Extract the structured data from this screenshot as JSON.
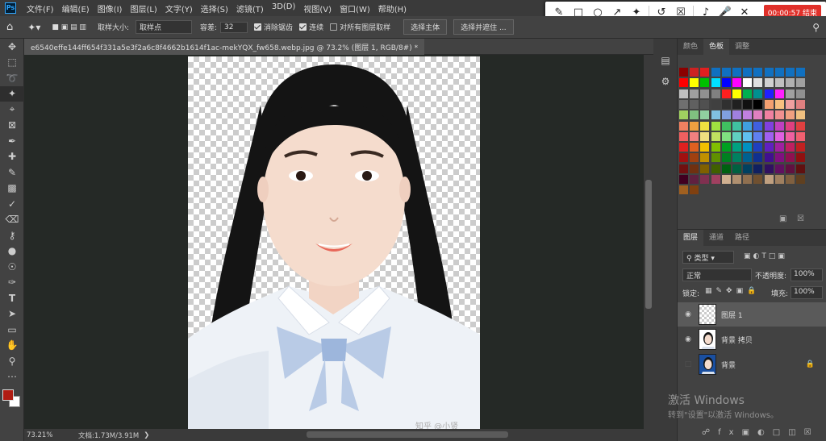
{
  "menu": [
    "文件(F)",
    "编辑(E)",
    "图像(I)",
    "图层(L)",
    "文字(Y)",
    "选择(S)",
    "滤镜(T)",
    "3D(D)",
    "视图(V)",
    "窗口(W)",
    "帮助(H)"
  ],
  "recorder": {
    "time": "00:00:57 结束",
    "icons": [
      "pen-icon",
      "square-icon",
      "circle-icon",
      "arrow-icon",
      "highlighter-icon",
      "undo-icon",
      "trash-icon",
      "speaker-icon",
      "mic-icon",
      "close-icon"
    ]
  },
  "options": {
    "sample_size_label": "取样大小:",
    "sample_size_value": "取样点",
    "tolerance_label": "容差:",
    "tolerance_value": "32",
    "antialias": "消除锯齿",
    "contiguous": "连续",
    "sample_all": "对所有图层取样",
    "select_subject": "选择主体",
    "select_and_mask": "选择并遮住 ..."
  },
  "document": {
    "tab_title": "e6540effe144ff654f331a5e3f2a6c8f4662b1614f1ac-mekYQX_fw658.webp.jpg @ 73.2% (图层 1, RGB/8#) *"
  },
  "status": {
    "zoom": "73.21%",
    "doc": "文档:1.73M/3.91M"
  },
  "panels": {
    "top_tabs": [
      "颜色",
      "色板",
      "调整"
    ],
    "top_active": "色板",
    "layer_tabs": [
      "图层",
      "通道",
      "路径"
    ],
    "layer_active": "图层",
    "kind": "类型",
    "blend": "正常",
    "opacity_label": "不透明度:",
    "opacity_value": "100%",
    "lock_label": "锁定:",
    "fill_label": "填充:",
    "fill_value": "100%",
    "layers": [
      {
        "name": "图层 1",
        "visible": true,
        "selected": true
      },
      {
        "name": "背景 拷贝",
        "visible": true,
        "selected": false
      },
      {
        "name": "背景",
        "visible": false,
        "selected": false,
        "locked": true
      }
    ]
  },
  "watermark": {
    "line1": "激活 Windows",
    "line2": "转到\"设置\"以激活 Windows。"
  },
  "photo_caption": "知乎 @小贤",
  "colors": {
    "foreground": "#b01c12",
    "background": "#ffffff",
    "swatch_rows": [
      [
        "#8b0000",
        "#cc2222",
        "#e02020",
        "#1070c0",
        "#1070c0",
        "#1070c0",
        "#1070c0",
        "#1070c0",
        "#1070c0",
        "#1070c0",
        "#1070c0",
        "#1070c0"
      ],
      [
        "#ff0000",
        "#ffff00",
        "#00c000",
        "#00e0ff",
        "#0000ff",
        "#ff00ff",
        "#ffffff",
        "#e0e0e0",
        "#d0d0d0",
        "#c0c0c0",
        "#b0b0b0",
        "#a0a0a0"
      ],
      [
        "#c0c0c0",
        "#a0a0a0",
        "#909090",
        "#808080",
        "#ff2020",
        "#ffff00",
        "#00b050",
        "#009090",
        "#2020ff",
        "#ff20ff",
        "#a0a0a0",
        "#909090"
      ],
      [
        "#707070",
        "#606060",
        "#505050",
        "#404040",
        "#303030",
        "#202020",
        "#101010",
        "#000000",
        "#f4a070",
        "#f8c080",
        "#f0a0a0",
        "#e08080"
      ],
      [
        "#a0d060",
        "#80c080",
        "#90d0a0",
        "#80c0e0",
        "#80a0e0",
        "#a080e0",
        "#c080e0",
        "#e080c0",
        "#f080a0",
        "#f09090",
        "#f0a080",
        "#f0c080"
      ],
      [
        "#f08060",
        "#f0a040",
        "#f0e040",
        "#a0e040",
        "#40c060",
        "#40c0a0",
        "#40a0e0",
        "#4060e0",
        "#8040e0",
        "#c040c0",
        "#e04080",
        "#e04040"
      ],
      [
        "#f06060",
        "#f08080",
        "#f0e080",
        "#c0e060",
        "#80e080",
        "#60d0c0",
        "#60c0f0",
        "#6080f0",
        "#a060f0",
        "#e060e0",
        "#f060a0",
        "#f06070"
      ],
      [
        "#e02020",
        "#e06020",
        "#f0c000",
        "#80c000",
        "#00a020",
        "#00a080",
        "#0090c0",
        "#2040c0",
        "#6020c0",
        "#a020a0",
        "#c02060",
        "#c02020"
      ],
      [
        "#a01010",
        "#a04010",
        "#c09000",
        "#609000",
        "#008020",
        "#008060",
        "#006090",
        "#103090",
        "#401090",
        "#801080",
        "#901050",
        "#901010"
      ],
      [
        "#701010",
        "#703010",
        "#806000",
        "#406000",
        "#006010",
        "#006040",
        "#004060",
        "#102060",
        "#301060",
        "#601060",
        "#601040",
        "#601010"
      ],
      [
        "#400020",
        "#602040",
        "#803050",
        "#a04060",
        "#d0b090",
        "#b09070",
        "#907050",
        "#705030",
        "#c0a080",
        "#a08060",
        "#806040",
        "#604020"
      ],
      [
        "#a06020",
        "#804010"
      ]
    ]
  }
}
